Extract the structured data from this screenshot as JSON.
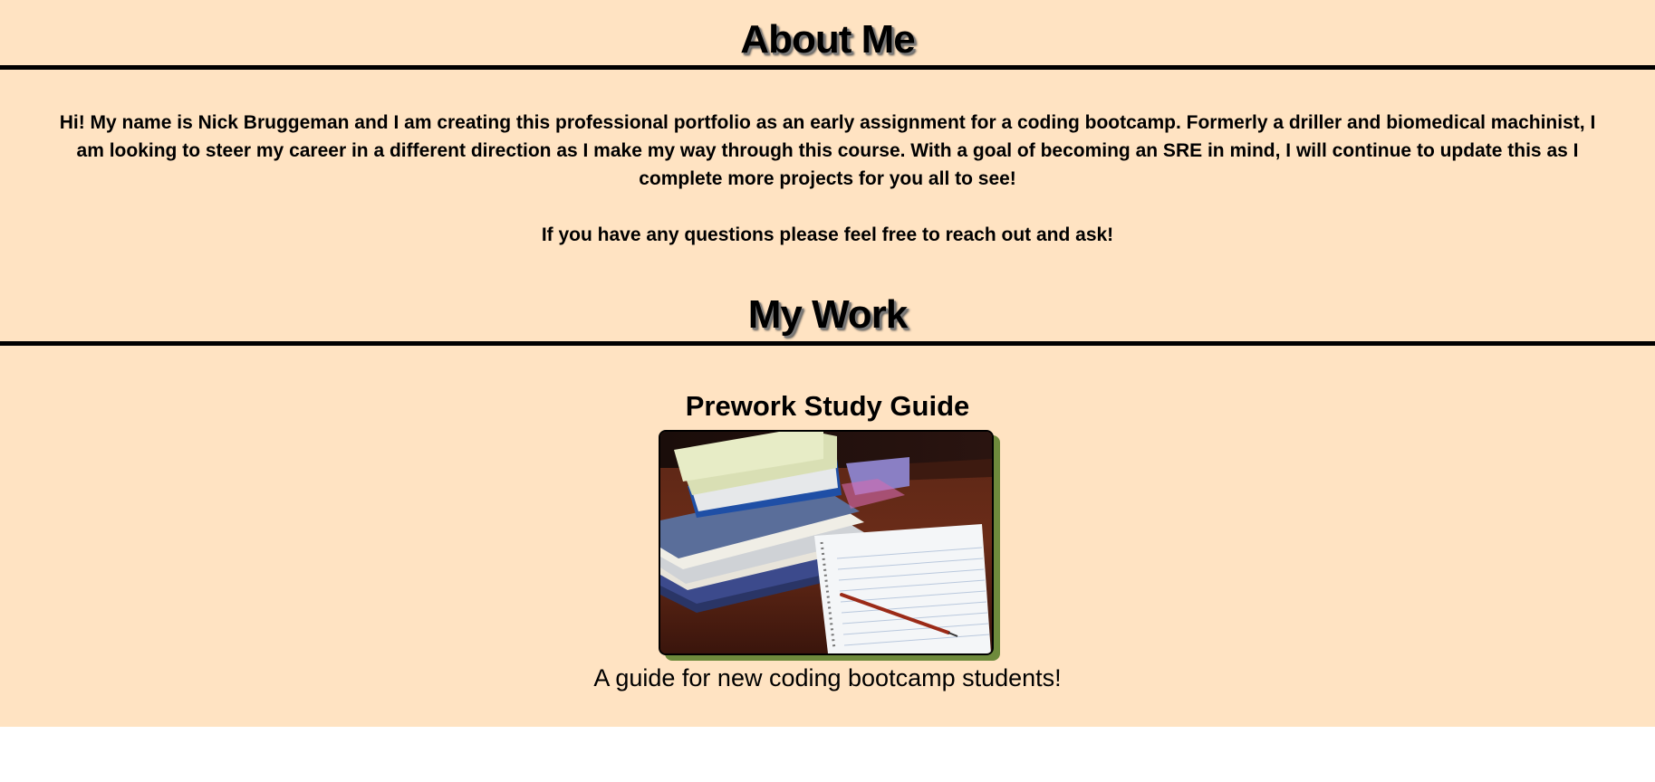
{
  "about": {
    "title": "About Me",
    "paragraph": "Hi! My name is Nick Bruggeman and I am creating this professional portfolio as an early assignment for a coding bootcamp. Formerly a driller and biomedical machinist, I am looking to steer my career in a different direction as I make my way through this course. With a goal of becoming an SRE in mind, I will continue to update this as I complete more projects for you all to see!",
    "contact_note": "If you have any questions please feel free to reach out and ask!"
  },
  "work": {
    "title": "My Work",
    "projects": [
      {
        "title": "Prework Study Guide",
        "image_alt": "Stack of books and a notebook with a pencil",
        "description": "A guide for new coding bootcamp students!"
      }
    ]
  },
  "colors": {
    "page_background": "#ffe3c2",
    "image_shadow": "#6e8a3c"
  }
}
